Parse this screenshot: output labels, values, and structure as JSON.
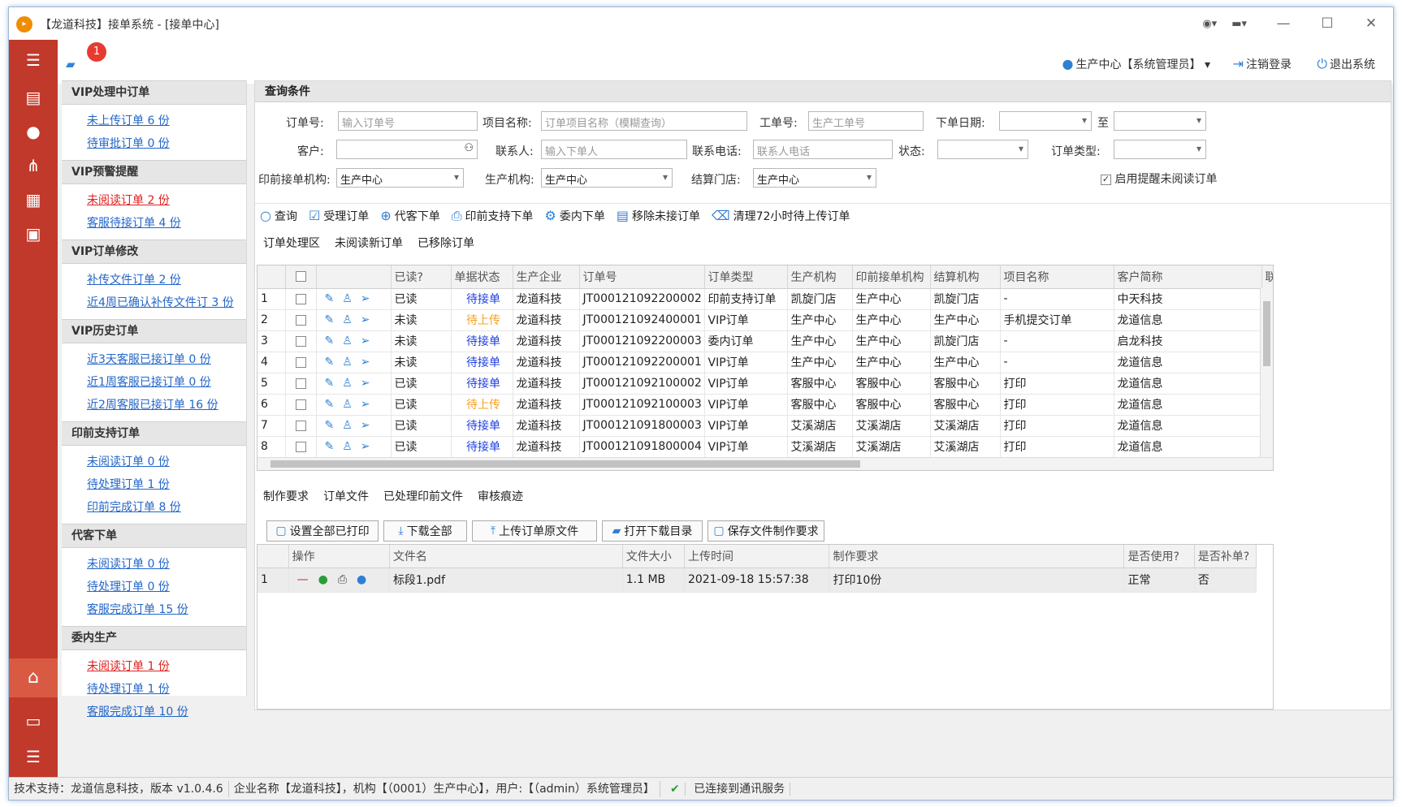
{
  "window": {
    "title": "【龙道科技】接单系统 - [接单中心]",
    "minimize": "—",
    "maximize": "☐",
    "close": "✕"
  },
  "topbar": {
    "badge_count": "1",
    "user": "生产中心【系统管理员】",
    "logout": "注销登录",
    "exit": "退出系统"
  },
  "nav": {
    "groups": [
      {
        "title": "VIP处理中订单",
        "items": [
          {
            "label": "未上传订单 6 份",
            "red": false
          },
          {
            "label": "待审批订单 0 份",
            "red": false
          }
        ]
      },
      {
        "title": "VIP预警提醒",
        "items": [
          {
            "label": "未阅读订单 2 份",
            "red": true
          },
          {
            "label": "客服待接订单 4 份",
            "red": false
          }
        ]
      },
      {
        "title": "VIP订单修改",
        "items": [
          {
            "label": "补传文件订单 2 份",
            "red": false
          },
          {
            "label": "近4周已确认补传文件订 3 份",
            "red": false
          }
        ]
      },
      {
        "title": "VIP历史订单",
        "items": [
          {
            "label": "近3天客服已接订单 0 份",
            "red": false
          },
          {
            "label": "近1周客服已接订单 0 份",
            "red": false
          },
          {
            "label": "近2周客服已接订单 16 份",
            "red": false
          }
        ]
      },
      {
        "title": "印前支持订单",
        "items": [
          {
            "label": "未阅读订单 0 份",
            "red": false
          },
          {
            "label": "待处理订单 1 份",
            "red": false
          },
          {
            "label": "印前完成订单 8 份",
            "red": false
          }
        ]
      },
      {
        "title": "代客下单",
        "items": [
          {
            "label": "未阅读订单 0 份",
            "red": false
          },
          {
            "label": "待处理订单 0 份",
            "red": false
          },
          {
            "label": "客服完成订单 15 份",
            "red": false
          }
        ]
      },
      {
        "title": "委内生产",
        "items": [
          {
            "label": "未阅读订单 1 份",
            "red": true
          },
          {
            "label": "待处理订单 1 份",
            "red": false
          },
          {
            "label": "客服完成订单 10 份",
            "red": false
          }
        ]
      }
    ]
  },
  "query": {
    "title": "查询条件",
    "order_no_label": "订单号:",
    "order_no_placeholder": "输入订单号",
    "project_label": "项目名称:",
    "project_placeholder": "订单项目名称（模糊查询）",
    "work_no_label": "工单号:",
    "work_no_placeholder": "生产工单号",
    "date_label": "下单日期:",
    "date_to": "至",
    "customer_label": "客户:",
    "contact_label": "联系人:",
    "contact_placeholder": "输入下单人",
    "phone_label": "联系电话:",
    "phone_placeholder": "联系人电话",
    "status_label": "状态:",
    "type_label": "订单类型:",
    "prepress_label": "印前接单机构:",
    "prepress_value": "生产中心",
    "prod_label": "生产机构:",
    "prod_value": "生产中心",
    "settle_label": "结算门店:",
    "settle_value": "生产中心",
    "remind_label": "启用提醒未阅读订单"
  },
  "toolbar": [
    "查询",
    "受理订单",
    "代客下单",
    "印前支持下单",
    "委内下单",
    "移除未接订单",
    "清理72小时待上传订单"
  ],
  "order_tabs": [
    "订单处理区",
    "未阅读新订单",
    "已移除订单"
  ],
  "orders": {
    "headers": [
      "已读?",
      "单据状态",
      "生产企业",
      "订单号",
      "订单类型",
      "生产机构",
      "印前接单机构",
      "结算机构",
      "项目名称",
      "客户简称",
      "联系"
    ],
    "rows": [
      {
        "n": "1",
        "read": "已读",
        "status": "待接单",
        "st": "blue",
        "company": "龙道科技",
        "no": "JT000121092200002",
        "type": "印前支持订单",
        "prod": "凯旋门店",
        "pre": "生产中心",
        "settle": "凯旋门店",
        "project": "-",
        "customer": "中天科技"
      },
      {
        "n": "2",
        "read": "未读",
        "status": "待上传",
        "st": "orange",
        "company": "龙道科技",
        "no": "JT000121092400001",
        "type": "VIP订单",
        "prod": "生产中心",
        "pre": "生产中心",
        "settle": "生产中心",
        "project": "手机提交订单",
        "customer": "龙道信息"
      },
      {
        "n": "3",
        "read": "未读",
        "status": "待接单",
        "st": "blue",
        "company": "龙道科技",
        "no": "JT000121092200003",
        "type": "委内订单",
        "prod": "生产中心",
        "pre": "生产中心",
        "settle": "凯旋门店",
        "project": "-",
        "customer": "启龙科技"
      },
      {
        "n": "4",
        "read": "未读",
        "status": "待接单",
        "st": "blue",
        "company": "龙道科技",
        "no": "JT000121092200001",
        "type": "VIP订单",
        "prod": "生产中心",
        "pre": "生产中心",
        "settle": "生产中心",
        "project": "-",
        "customer": "龙道信息"
      },
      {
        "n": "5",
        "read": "已读",
        "status": "待接单",
        "st": "blue",
        "company": "龙道科技",
        "no": "JT000121092100002",
        "type": "VIP订单",
        "prod": "客服中心",
        "pre": "客服中心",
        "settle": "客服中心",
        "project": "打印",
        "customer": "龙道信息"
      },
      {
        "n": "6",
        "read": "已读",
        "status": "待上传",
        "st": "orange",
        "company": "龙道科技",
        "no": "JT000121092100003",
        "type": "VIP订单",
        "prod": "客服中心",
        "pre": "客服中心",
        "settle": "客服中心",
        "project": "打印",
        "customer": "龙道信息"
      },
      {
        "n": "7",
        "read": "已读",
        "status": "待接单",
        "st": "blue",
        "company": "龙道科技",
        "no": "JT000121091800003",
        "type": "VIP订单",
        "prod": "艾溪湖店",
        "pre": "艾溪湖店",
        "settle": "艾溪湖店",
        "project": "打印",
        "customer": "龙道信息"
      },
      {
        "n": "8",
        "read": "已读",
        "status": "待接单",
        "st": "blue",
        "company": "龙道科技",
        "no": "JT000121091800004",
        "type": "VIP订单",
        "prod": "艾溪湖店",
        "pre": "艾溪湖店",
        "settle": "艾溪湖店",
        "project": "打印",
        "customer": "龙道信息"
      }
    ]
  },
  "file_tabs": [
    "制作要求",
    "订单文件",
    "已处理印前文件",
    "审核痕迹"
  ],
  "file_buttons": [
    "设置全部已打印",
    "下载全部",
    "上传订单原文件",
    "打开下载目录",
    "保存文件制作要求"
  ],
  "files": {
    "headers": [
      "操作",
      "文件名",
      "文件大小",
      "上传时间",
      "制作要求",
      "是否使用?",
      "是否补单?"
    ],
    "rows": [
      {
        "n": "1",
        "name": "标段1.pdf",
        "size": "1.1 MB",
        "time": "2021-09-18 15:57:38",
        "req": "打印10份",
        "used": "正常",
        "extra": "否"
      }
    ]
  },
  "status": {
    "support": "技术支持：龙道信息科技，版本 v1.0.4.6",
    "company": "企业名称【龙道科技】，机构【（0001）生产中心】，用户:【（admin）系统管理员】",
    "conn": "已连接到通讯服务"
  },
  "colors": {
    "sidebar": "#c0392b",
    "accent": "#2f7fd5",
    "link": "#2366c8",
    "warn": "#e02020"
  }
}
